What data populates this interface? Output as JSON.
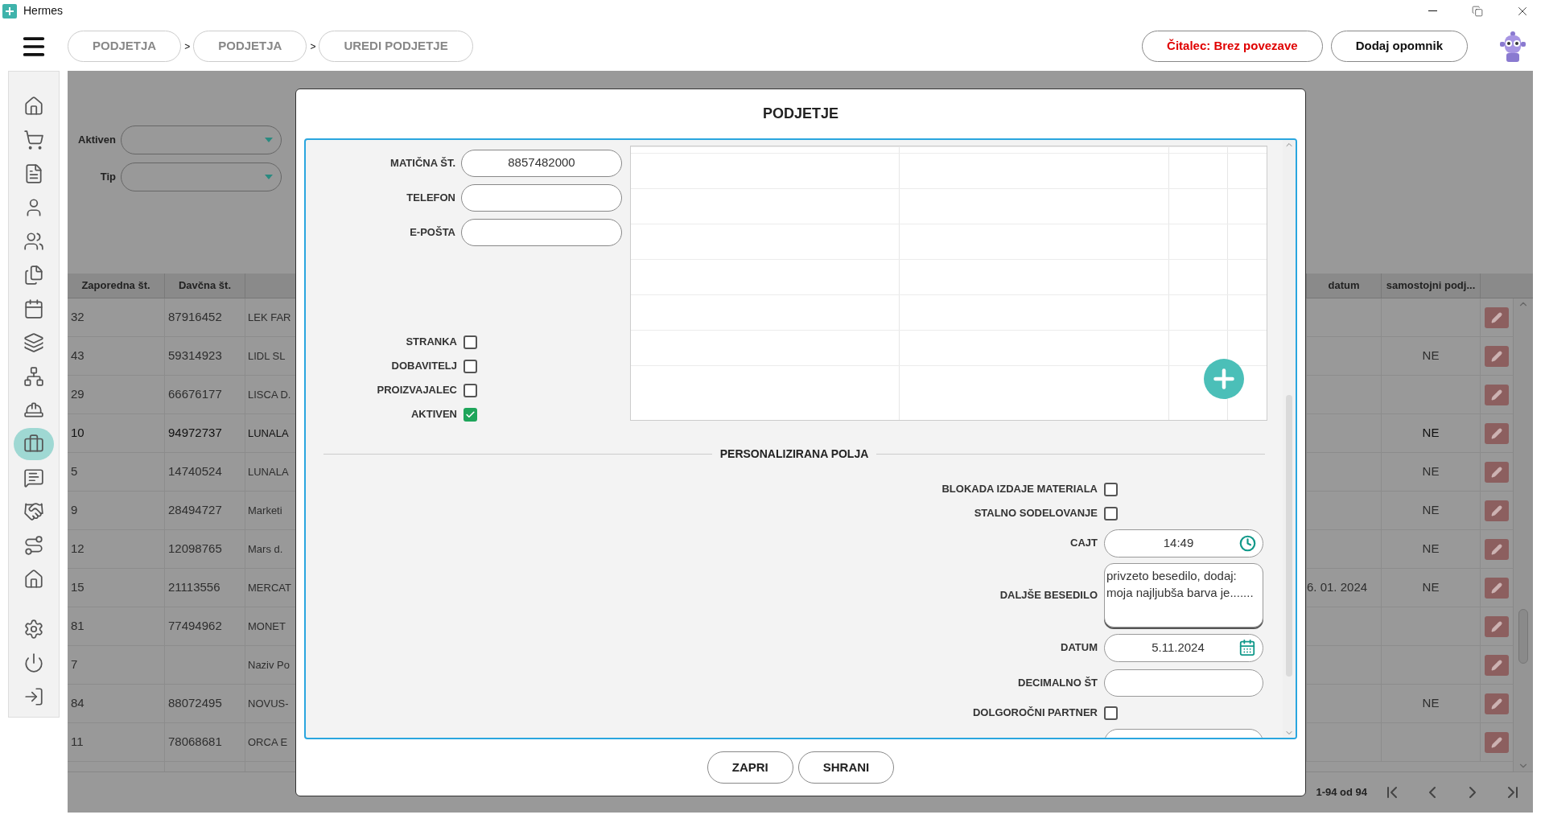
{
  "window": {
    "title": "Hermes"
  },
  "breadcrumbs": [
    {
      "label": "PODJETJA",
      "separator": ">"
    },
    {
      "label": "PODJETJA",
      "separator": ">"
    },
    {
      "label": "UREDI PODJETJE"
    }
  ],
  "header_buttons": [
    {
      "label": "Čitalec: Brez povezave",
      "kind": "warning"
    },
    {
      "label": "Dodaj opomnik",
      "kind": "normal"
    }
  ],
  "sidebar": {
    "items": [
      {
        "selected": false
      },
      {
        "selected": false
      },
      {
        "selected": false
      },
      {
        "selected": false
      },
      {
        "selected": false
      },
      {
        "selected": false
      },
      {
        "selected": false
      },
      {
        "selected": false
      },
      {
        "selected": false
      },
      {
        "selected": false
      },
      {
        "selected": true
      },
      {
        "selected": false
      },
      {
        "selected": false
      },
      {
        "selected": false
      },
      {
        "selected": false
      },
      {
        "selected": false
      },
      {
        "selected": false
      },
      {
        "selected": false
      }
    ]
  },
  "filters": [
    {
      "label": "Aktiven"
    },
    {
      "label": "Tip"
    }
  ],
  "table": {
    "columns": [
      "Zaporedna št.",
      "Davčna št.",
      "datum",
      "samostojni podj..."
    ],
    "rows": [
      {
        "number": "32",
        "tax": "87916452",
        "name": "LEK FAR",
        "selected": false
      },
      {
        "number": "43",
        "tax": "59314923",
        "name": "LIDL SL",
        "standalone": "NE",
        "selected": false
      },
      {
        "number": "29",
        "tax": "66676177",
        "name": "LISCA D.",
        "selected": false
      },
      {
        "number": "10",
        "tax": "94972737",
        "name": "LUNALA",
        "standalone": "NE",
        "selected": true
      },
      {
        "number": "5",
        "tax": "14740524",
        "name": "LUNALA",
        "standalone": "NE",
        "selected": false
      },
      {
        "number": "9",
        "tax": "28494727",
        "name": "Marketi",
        "standalone": "NE",
        "selected": false
      },
      {
        "number": "12",
        "tax": "12098765",
        "name": "Mars d.",
        "standalone": "NE",
        "selected": false
      },
      {
        "number": "15",
        "tax": "21113556",
        "name": "MERCAT",
        "date": "6. 01. 2024",
        "standalone": "NE",
        "selected": false
      },
      {
        "number": "81",
        "tax": "77494962",
        "name": "MONET",
        "selected": false
      },
      {
        "number": "7",
        "name": "Naziv Po",
        "selected": false
      },
      {
        "number": "84",
        "tax": "88072495",
        "name": "NOVUS-",
        "standalone": "NE",
        "selected": false
      },
      {
        "number": "11",
        "tax": "78068681",
        "name": "ORCA E",
        "selected": false
      }
    ]
  },
  "pagination": {
    "range": "1-94 od 94"
  },
  "dialog": {
    "title": "PODJETJE",
    "fields": [
      {
        "label": "MATIČNA ŠT.",
        "value": "8857482000"
      },
      {
        "label": "TELEFON"
      },
      {
        "label": "E-POŠTA"
      }
    ],
    "flags": [
      {
        "label": "STRANKA",
        "checked": false
      },
      {
        "label": "DOBAVITELJ",
        "checked": false
      },
      {
        "label": "PROIZVAJALEC",
        "checked": false
      },
      {
        "label": "AKTIVEN",
        "checked": true
      }
    ],
    "section_title": "PERSONALIZIRANA POLJA",
    "custom_fields": [
      {
        "kind": "checkbox",
        "label": "BLOKADA IZDAJE MATERIALA",
        "checked": false
      },
      {
        "kind": "checkbox",
        "label": "STALNO SODELOVANJE",
        "checked": false
      },
      {
        "kind": "time",
        "label": "CAJT",
        "value": "14:49"
      },
      {
        "kind": "textarea",
        "label": "DALJŠE BESEDILO",
        "value": "privzeto besedilo, dodaj:\nmoja najljubša barva je......."
      },
      {
        "kind": "date",
        "label": "DATUM",
        "value": "5.11.2024"
      },
      {
        "kind": "text",
        "label": "DECIMALNO ŠT"
      },
      {
        "kind": "checkbox",
        "label": "DOLGOROČNI PARTNER",
        "checked": false
      },
      {
        "kind": "text"
      }
    ],
    "buttons": [
      "ZAPRI",
      "SHRANI"
    ]
  }
}
